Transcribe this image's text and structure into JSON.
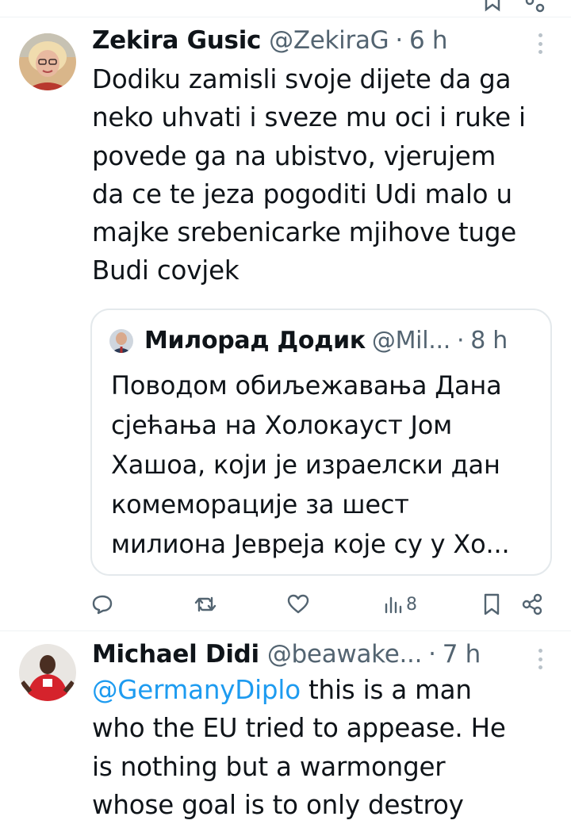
{
  "tweets": [
    {
      "name": "Zekira Gusic",
      "handle": "@ZekiraG",
      "separator": "·",
      "time": "6 h",
      "text_lines": [
        "Dodiku zamisli svoje dijete da ga",
        "neko uhvati i sveze mu oci i ruke i",
        "povede ga na ubistvo, vjerujem",
        "da ce te jeza pogoditi Udi malo u",
        "majke srebenicarke mjihove tuge",
        "Budi covjek"
      ],
      "quoted": {
        "name": "Милорад Додик",
        "handle": "@Mil...",
        "separator": "·",
        "time": "8 h",
        "text_lines": [
          "Поводом обиљежавања Дана",
          "сјећања на Холокауст Јом",
          "Хашоа, који је израелски дан",
          "комеморације за шест",
          "милиона Јевреја које су у Хо..."
        ]
      },
      "actions": {
        "reply": {
          "icon": "reply-icon"
        },
        "retweet": {
          "icon": "retweet-icon"
        },
        "like": {
          "icon": "heart-icon"
        },
        "views": {
          "icon": "views-icon",
          "count": "8"
        },
        "bookmark": {
          "icon": "bookmark-icon"
        },
        "share": {
          "icon": "share-icon"
        }
      }
    },
    {
      "name": "Michael Didi",
      "handle": "@beawake...",
      "separator": "·",
      "time": "7 h",
      "mention": "@GermanyDiplo",
      "text_lines": [
        " this is a man",
        "who the EU tried to appease. He",
        "is nothing but a warmonger",
        "whose goal is to only destroy"
      ]
    }
  ],
  "colors": {
    "text": "#0f1419",
    "secondary": "#536471",
    "link": "#1d9bf0",
    "border": "#e4e9ec"
  }
}
